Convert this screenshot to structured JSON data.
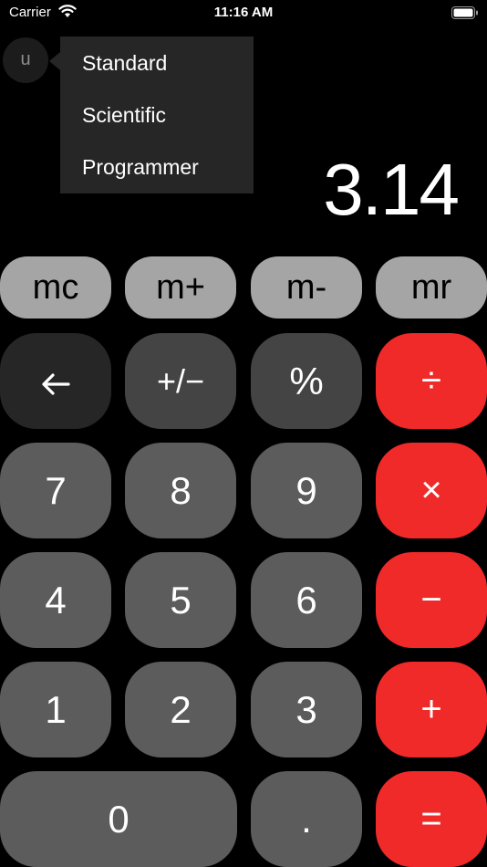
{
  "status_bar": {
    "carrier": "Carrier",
    "time": "11:16 AM"
  },
  "mode_toggle": {
    "label": "u"
  },
  "mode_menu": {
    "items": [
      "Standard",
      "Scientific",
      "Programmer"
    ]
  },
  "display": {
    "value": "3.14"
  },
  "memory": {
    "mc": "mc",
    "m_plus": "m+",
    "m_minus": "m-",
    "mr": "mr"
  },
  "keys": {
    "backspace_icon": "left-arrow",
    "sign": "+/−",
    "percent": "%",
    "divide": "÷",
    "seven": "7",
    "eight": "8",
    "nine": "9",
    "multiply": "×",
    "four": "4",
    "five": "5",
    "six": "6",
    "minus": "−",
    "one": "1",
    "two": "2",
    "three": "3",
    "plus": "+",
    "zero": "0",
    "decimal": ".",
    "equals": "="
  },
  "colors": {
    "background": "#000000",
    "operator": "#f02929",
    "digit": "#5c5c5c",
    "function": "#444444",
    "memory": "#a5a5a5"
  }
}
